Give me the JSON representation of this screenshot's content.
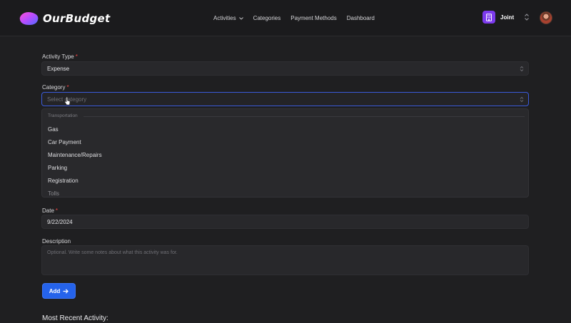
{
  "app": {
    "name": "OurBudget"
  },
  "nav": {
    "items": [
      {
        "label": "Activities",
        "has_dropdown": true
      },
      {
        "label": "Categories",
        "has_dropdown": false
      },
      {
        "label": "Payment Methods",
        "has_dropdown": false
      },
      {
        "label": "Dashboard",
        "has_dropdown": false
      }
    ]
  },
  "team": {
    "name": "Joint",
    "badge_color": "#7c3aed"
  },
  "form": {
    "activity_type": {
      "label": "Activity Type",
      "required": "*",
      "value": "Expense"
    },
    "category": {
      "label": "Category",
      "required": "*",
      "placeholder": "Select category",
      "dropdown": {
        "group": "Transportation",
        "options": [
          "Gas",
          "Car Payment",
          "Maintenance/Repairs",
          "Parking",
          "Registration",
          "Tolls"
        ]
      }
    },
    "date": {
      "label": "Date",
      "required": "*",
      "value": "9/22/2024"
    },
    "description": {
      "label": "Description",
      "placeholder": "Optional. Write some notes about what this activity was for."
    },
    "submit": {
      "label": "Add"
    }
  },
  "recent": {
    "heading": "Most Recent Activity:"
  },
  "colors": {
    "accent": "#2563eb",
    "required": "#ef4444",
    "background": "#1f1f21"
  }
}
